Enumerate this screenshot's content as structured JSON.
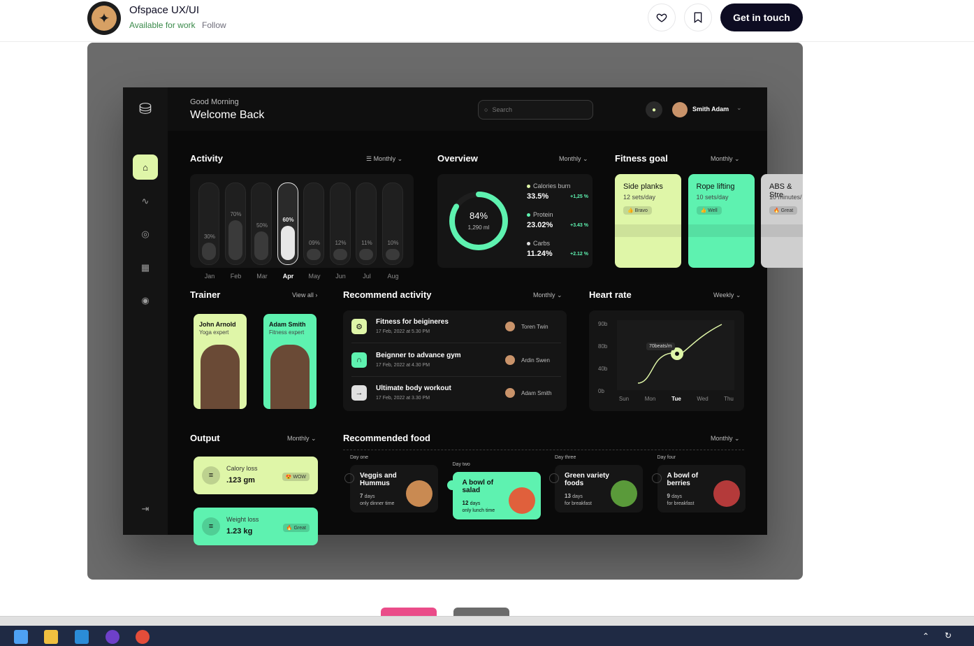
{
  "header": {
    "studio_name": "Ofspace UX/UI",
    "availability": "Available for work",
    "follow": "Follow",
    "cta": "Get in touch",
    "like_icon": "heart-icon",
    "save_icon": "bookmark-icon"
  },
  "dashboard": {
    "greeting": "Good Morning",
    "welcome": "Welcome Back",
    "search_placeholder": "Search",
    "user_name": "Smith Adam",
    "activity": {
      "title": "Activity",
      "period": "Monthly",
      "bars": [
        {
          "month": "Jan",
          "pct": "30%",
          "fraction": 0.3
        },
        {
          "month": "Feb",
          "pct": "70%",
          "fraction": 0.7
        },
        {
          "month": "Mar",
          "pct": "50%",
          "fraction": 0.5
        },
        {
          "month": "Apr",
          "pct": "60%",
          "fraction": 0.6
        },
        {
          "month": "May",
          "pct": "09%",
          "fraction": 0.09
        },
        {
          "month": "Jun",
          "pct": "12%",
          "fraction": 0.12
        },
        {
          "month": "Jul",
          "pct": "11%",
          "fraction": 0.11
        },
        {
          "month": "Aug",
          "pct": "10%",
          "fraction": 0.1
        }
      ],
      "selected_month": "Apr"
    },
    "overview": {
      "title": "Overview",
      "period": "Monthly",
      "ring_pct": "84%",
      "ring_sub": "1,290 ml",
      "ring_fraction": 0.84,
      "items": [
        {
          "name": "Calories burn",
          "value": "33.5%",
          "delta": "+1,25 %",
          "color": "#dff6a8"
        },
        {
          "name": "Protein",
          "value": "23.02%",
          "delta": "+3.43 %",
          "color": "#5ef2b0"
        },
        {
          "name": "Carbs",
          "value": "11.24%",
          "delta": "+2.12 %",
          "color": "#e0e0e0"
        }
      ]
    },
    "fitness_goal": {
      "title": "Fitness goal",
      "period": "Monthly",
      "cards": [
        {
          "title": "Side planks",
          "sub": "12 sets/day",
          "badge": "👍 Bravo",
          "color": "#dff6a8"
        },
        {
          "title": "Rope lifting",
          "sub": "10 sets/day",
          "badge": "👍 Well",
          "color": "#5ef2b0"
        },
        {
          "title": "ABS & Stre",
          "sub": "10 minutes/",
          "badge": "🔥 Great",
          "color": "#cfcfcf"
        }
      ]
    },
    "trainer": {
      "title": "Trainer",
      "view_all": "View all",
      "cards": [
        {
          "name": "John Arnold",
          "role": "Yoga expert",
          "color": "#dff6a8"
        },
        {
          "name": "Adam Smith",
          "role": "Fitness expert",
          "color": "#5ef2b0"
        }
      ]
    },
    "recommend": {
      "title": "Recommend activity",
      "period": "Monthly",
      "rows": [
        {
          "title": "Fitness for beigineres",
          "date": "17 Feb, 2022 at 5.30 PM",
          "person": "Toren Twin",
          "color": "#dff6a8",
          "icon": "⚙"
        },
        {
          "title": "Beignner to advance gym",
          "date": "17 Feb, 2022 at 4.30 PM",
          "person": "Ardin Swen",
          "color": "#5ef2b0",
          "icon": "∩"
        },
        {
          "title": "Ultimate body workout",
          "date": "17 Feb, 2022 at 3.30 PM",
          "person": "Adam Smith",
          "color": "#e0e0e0",
          "icon": "→"
        }
      ]
    },
    "heart_rate": {
      "title": "Heart rate",
      "period": "Weekly",
      "tooltip": "70beats/m",
      "y_labels": [
        "90b",
        "80b",
        "40b",
        "0b"
      ],
      "x_labels": [
        "Sun",
        "Mon",
        "Tue",
        "Wed",
        "Thu"
      ],
      "selected_day": "Tue"
    },
    "output": {
      "title": "Output",
      "period": "Monthly",
      "cards": [
        {
          "label": "Calory loss",
          "value": ".123 gm",
          "badge": "😍 WOW",
          "color": "#dff6a8"
        },
        {
          "label": "Weight loss",
          "value": "1.23 kg",
          "badge": "🔥 Great",
          "color": "#5ef2b0"
        }
      ]
    },
    "food": {
      "title": "Recommended food",
      "period": "Monthly",
      "items": [
        {
          "day": "Day one",
          "name": "Veggis and Hummus",
          "days": "7",
          "note": "only dinner time"
        },
        {
          "day": "Day two",
          "name": "A bowl of salad",
          "days": "12",
          "note": "only lunch time"
        },
        {
          "day": "Day three",
          "name": "Green variety foods",
          "days": "13",
          "note": "for breakfast"
        },
        {
          "day": "Day four",
          "name": "A bowl of berries",
          "days": "9",
          "note": "for breakfast"
        }
      ],
      "days_unit": "days"
    }
  }
}
